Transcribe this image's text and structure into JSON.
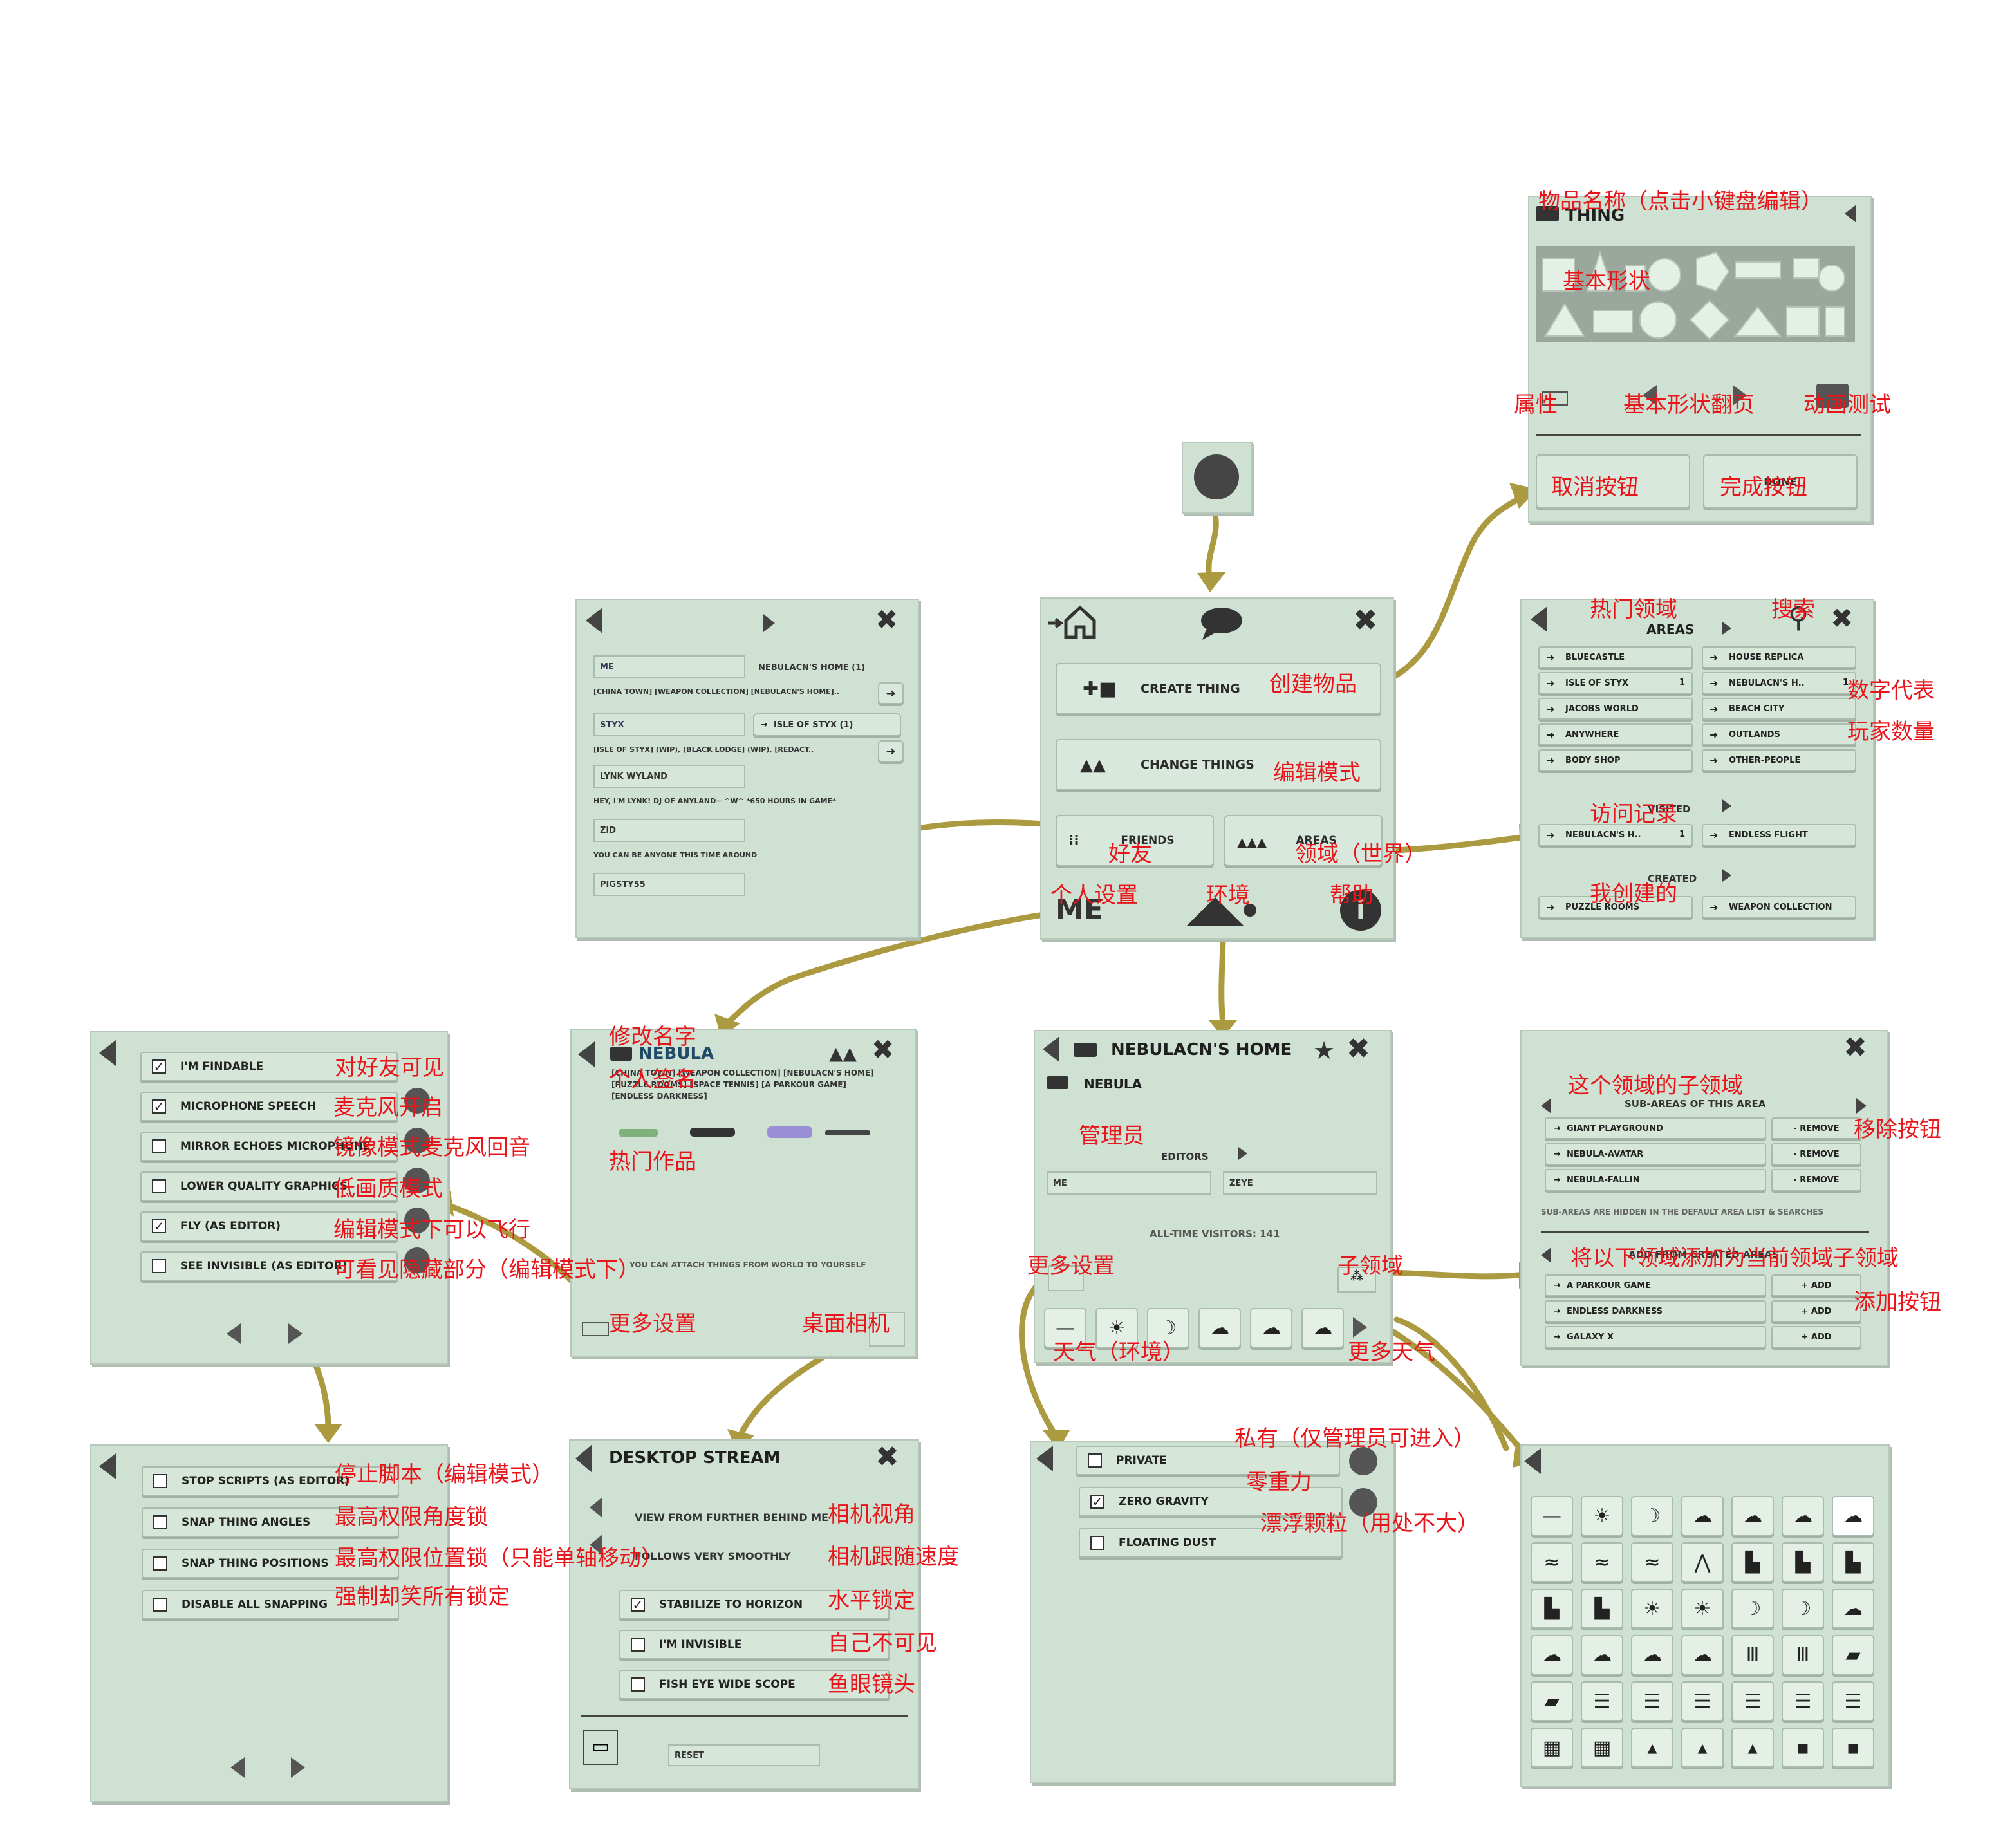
{
  "colors": {
    "panel": "#cfe1d3",
    "arrow": "#ab9a3f",
    "annotation": "#e8161b"
  },
  "icons": [
    "circle-button-icon",
    "home-icon",
    "speech-bubble-icon",
    "close-icon",
    "back-arrow-icon",
    "forward-arrow-icon",
    "keyboard-icon",
    "search-icon",
    "star-icon",
    "info-icon",
    "twitch-icon",
    "mountain-icon",
    "weather-icon"
  ],
  "thing": {
    "title": "THING",
    "done": "DONE"
  },
  "main": {
    "create": "CREATE THING",
    "change": "CHANGE THINGS",
    "friends": "FRIENDS",
    "areas": "AREAS",
    "me": "ME"
  },
  "friends_panel": {
    "me": "ME",
    "me_home": "NEBULACN'S HOME (1)",
    "me_desc": "[CHINA TOWN] [WEAPON COLLECTION] [NEBULACN'S HOME]..",
    "styx": "STYX",
    "styx_area": "ISLE OF STYX (1)",
    "styx_desc": "[ISLE OF STYX] (WIP), [BLACK LODGE] (WIP), [REDACT..",
    "lynk": "LYNK WYLAND",
    "lynk_desc": "HEY, I'M LYNK! DJ OF ANYLAND~ ^W^ *650 HOURS IN GAME*",
    "zid": "ZID",
    "zid_desc": "YOU CAN BE ANYONE THIS TIME AROUND",
    "pig": "PIGSTY55"
  },
  "areas_panel": {
    "title": "AREAS",
    "list": [
      {
        "name": "BLUECASTLE",
        "count": ""
      },
      {
        "name": "HOUSE REPLICA",
        "count": ""
      },
      {
        "name": "ISLE OF STYX",
        "count": "1"
      },
      {
        "name": "NEBULACN'S H..",
        "count": "1"
      },
      {
        "name": "JACOBS WORLD",
        "count": ""
      },
      {
        "name": "BEACH CITY",
        "count": ""
      },
      {
        "name": "ANYWHERE",
        "count": ""
      },
      {
        "name": "OUTLANDS",
        "count": ""
      },
      {
        "name": "BODY SHOP",
        "count": ""
      },
      {
        "name": "OTHER-PEOPLE",
        "count": ""
      }
    ],
    "visited_label": "VISITED",
    "visited": [
      {
        "name": "NEBULACN'S H..",
        "count": "1"
      },
      {
        "name": "ENDLESS FLIGHT",
        "count": ""
      }
    ],
    "created_label": "CREATED",
    "created": [
      {
        "name": "PUZZLE ROOMS",
        "count": ""
      },
      {
        "name": "WEAPON COLLECTION",
        "count": ""
      }
    ]
  },
  "me_options": {
    "items": [
      {
        "label": "I'M FINDABLE",
        "checked": true
      },
      {
        "label": "MICROPHONE SPEECH",
        "checked": true
      },
      {
        "label": "MIRROR ECHOES MICROPHONE",
        "checked": false
      },
      {
        "label": "LOWER QUALITY GRAPHICS",
        "checked": false
      },
      {
        "label": "FLY (AS EDITOR)",
        "checked": true
      },
      {
        "label": "SEE INVISIBLE (AS EDITOR)",
        "checked": false
      }
    ]
  },
  "me_options2": {
    "items": [
      {
        "label": "STOP SCRIPTS (AS EDITOR)",
        "checked": false
      },
      {
        "label": "SNAP THING ANGLES",
        "checked": false
      },
      {
        "label": "SNAP THING POSITIONS",
        "checked": false
      },
      {
        "label": "DISABLE ALL SNAPPING",
        "checked": false
      }
    ]
  },
  "profile": {
    "name": "NEBULA",
    "desc": "[CHINA TOWN] [WEAPON COLLECTION] [NEBULACN'S HOME] [PUZZLE ROOMS] [SPACE TENNIS] [A PARKOUR GAME] [ENDLESS DARKNESS]",
    "hint": "YOU CAN ATTACH THINGS FROM WORLD TO YOURSELF"
  },
  "desktop": {
    "title": "DESKTOP STREAM",
    "view": "VIEW FROM FURTHER BEHIND ME",
    "follows": "FOLLOWS VERY SMOOTHLY",
    "items": [
      {
        "label": "STABILIZE TO HORIZON",
        "checked": true
      },
      {
        "label": "I'M INVISIBLE",
        "checked": false
      },
      {
        "label": "FISH EYE WIDE SCOPE",
        "checked": false
      }
    ],
    "reset": "RESET"
  },
  "home": {
    "title": "NEBULACN'S HOME",
    "owner": "NEBULA",
    "editors_label": "EDITORS",
    "editors": [
      "ME",
      "ZEYE"
    ],
    "visitors": "ALL-TIME VISITORS: 141"
  },
  "env": {
    "items": [
      {
        "label": "PRIVATE",
        "checked": false
      },
      {
        "label": "ZERO GRAVITY",
        "checked": true
      },
      {
        "label": "FLOATING DUST",
        "checked": false
      }
    ]
  },
  "subareas": {
    "title": "SUB-AREAS OF THIS AREA",
    "list": [
      "GIANT PLAYGROUND",
      "NEBULA-AVATAR",
      "NEBULA-FALLIN"
    ],
    "remove": "- REMOVE",
    "note": "SUB-AREAS ARE HIDDEN IN THE DEFAULT AREA LIST & SEARCHES",
    "add_title": "ADD FROM CREATED AREAS",
    "add_list": [
      "A PARKOUR GAME",
      "ENDLESS DARKNESS",
      "GALAXY X"
    ],
    "add": "+ ADD"
  },
  "ann": {
    "thing_name": "物品名称（点击小键盘编辑）",
    "basic_shape": "基本形状",
    "attr": "属性",
    "shape_page": "基本形状翻页",
    "anim": "动画测试",
    "cancel": "取消按钮",
    "done": "完成按钮",
    "create": "创建物品",
    "edit": "编辑模式",
    "friend": "好友",
    "area_world": "领域（世界）",
    "me_settings": "个人设置",
    "env": "环境",
    "help": "帮助",
    "hot_area": "热门领域",
    "search": "搜索",
    "num1": "数字代表",
    "num2": "玩家数量",
    "visited": "访问记录",
    "created": "我创建的",
    "friend_vis": "对好友可见",
    "mic": "麦克风开启",
    "mirror": "镜像模式麦克风回音",
    "lowq": "低画质模式",
    "fly": "编辑模式下可以飞行",
    "seeinv": "可看见隐藏部分（编辑模式下）",
    "rename": "修改名字",
    "sign": "个人签名",
    "hot_work": "热门作品",
    "more_settings": "更多设置",
    "desktop_cam": "桌面相机",
    "stop_scripts": "停止脚本（编辑模式）",
    "snap_angle": "最高权限角度锁",
    "snap_pos": "最高权限位置锁（只能单轴移动）",
    "disable_snap": "强制却笑所有锁定",
    "cam_view": "相机视角",
    "cam_follow": "相机跟随速度",
    "horizon": "水平锁定",
    "invisible": "自己不可见",
    "fisheye": "鱼眼镜头",
    "admin": "管理员",
    "more_settings2": "更多设置",
    "subarea": "子领域",
    "weather": "天气（环境）",
    "more_weather": "更多天气",
    "private": "私有（仅管理员可进入）",
    "zero_g": "零重力",
    "dust": "漂浮颗粒（用处不大）",
    "sub_of_this": "这个领域的子领域",
    "remove_btn": "移除按钮",
    "add_as_sub": "将以下领域添加为当前领域子领域",
    "add_btn": "添加按钮"
  }
}
